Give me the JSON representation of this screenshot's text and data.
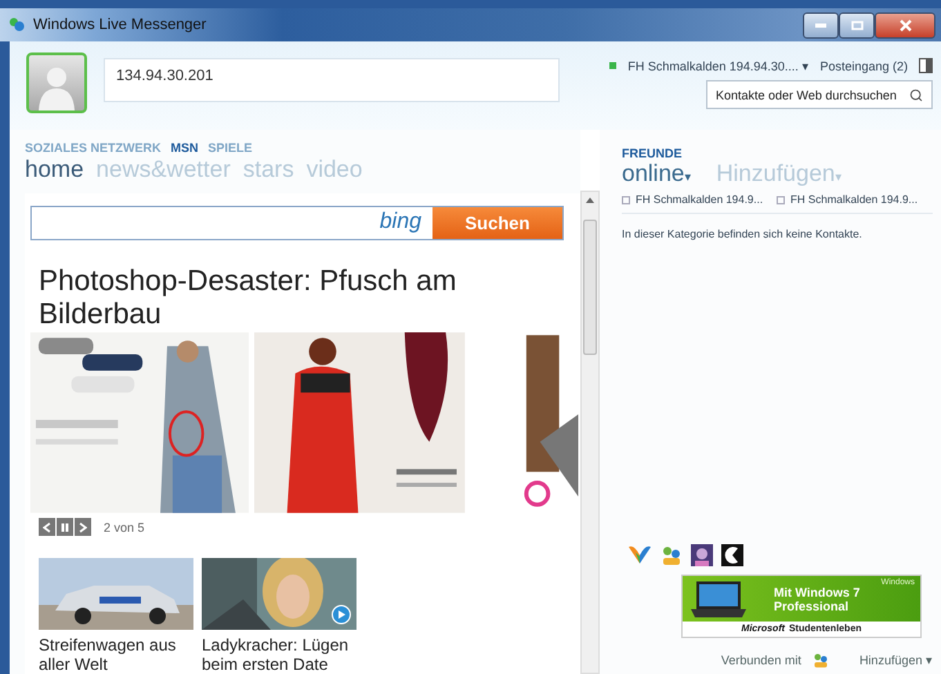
{
  "window": {
    "title": "Windows Live Messenger"
  },
  "profile": {
    "message": "134.94.30.201"
  },
  "status": {
    "label": "FH Schmalkalden 194.94.30....",
    "caret": "▾",
    "inbox": "Posteingang (2)"
  },
  "search": {
    "placeholder": "Kontakte oder Web durchsuchen"
  },
  "sections": [
    {
      "label": "SOZIALES NETZWERK",
      "selected": false
    },
    {
      "label": "MSN",
      "selected": true
    },
    {
      "label": "SPIELE",
      "selected": false
    }
  ],
  "tabs": [
    {
      "label": "home",
      "selected": true
    },
    {
      "label": "news&wetter",
      "selected": false
    },
    {
      "label": "stars",
      "selected": false
    },
    {
      "label": "video",
      "selected": false
    }
  ],
  "bing": {
    "logo": "bing",
    "button": "Suchen"
  },
  "headline": "Photoshop-Desaster: Pfusch am Bilderbau",
  "slideshow": {
    "counter": "2 von 5"
  },
  "teasers": [
    {
      "caption": "Streifenwagen aus aller Welt",
      "kind": "car",
      "video": false
    },
    {
      "caption": "Ladykracher: Lügen beim ersten Date",
      "kind": "person",
      "video": true
    }
  ],
  "friends": {
    "heading": "FREUNDE",
    "views": [
      {
        "label": "online",
        "caret": "▾",
        "selected": true
      },
      {
        "label": "Hinzufügen",
        "caret": "▾",
        "selected": false
      }
    ],
    "groups": [
      "FH Schmalkalden 194.9...",
      "FH Schmalkalden 194.9..."
    ],
    "empty": "In dieser Kategorie befinden sich keine Kontakte."
  },
  "ad": {
    "badge": "Windows",
    "text": "Mit Windows 7 Professional",
    "brand": "Microsoft",
    "tagline": "Studentenleben"
  },
  "footer": {
    "connected": "Verbunden mit",
    "add": "Hinzufügen",
    "caret": "▾"
  }
}
